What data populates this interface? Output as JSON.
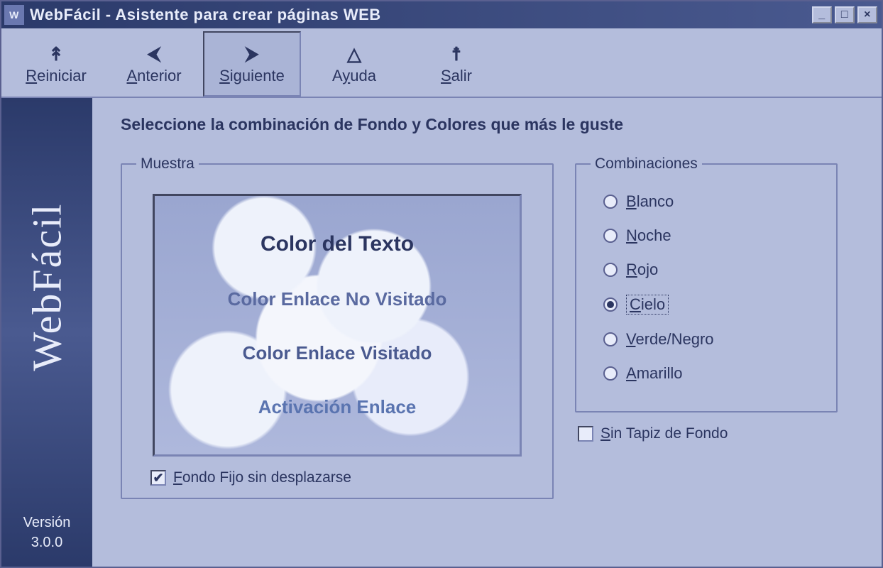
{
  "window": {
    "title": "WebFácil - Asistente para crear páginas WEB"
  },
  "toolbar": {
    "reiniciar": "Reiniciar",
    "anterior": "Anterior",
    "siguiente": "Siguiente",
    "ayuda": "Ayuda",
    "salir": "Salir",
    "active": "siguiente"
  },
  "sidebar": {
    "logo": "WebFácil",
    "version_label": "Versión",
    "version_value": "3.0.0"
  },
  "content": {
    "heading": "Seleccione la combinación de Fondo y Colores que más le guste",
    "muestra": {
      "legend": "Muestra",
      "text_color": "Color del Texto",
      "link_unvisited": "Color Enlace No Visitado",
      "link_visited": "Color Enlace Visitado",
      "link_active": "Activación Enlace",
      "fixed_bg_label": "Fondo Fijo sin desplazarse",
      "fixed_bg_checked": true
    },
    "combinaciones": {
      "legend": "Combinaciones",
      "options": [
        "Blanco",
        "Noche",
        "Rojo",
        "Cielo",
        "Verde/Negro",
        "Amarillo"
      ],
      "selected": "Cielo",
      "sin_tapiz_label": "Sin Tapiz de Fondo",
      "sin_tapiz_checked": false
    }
  }
}
